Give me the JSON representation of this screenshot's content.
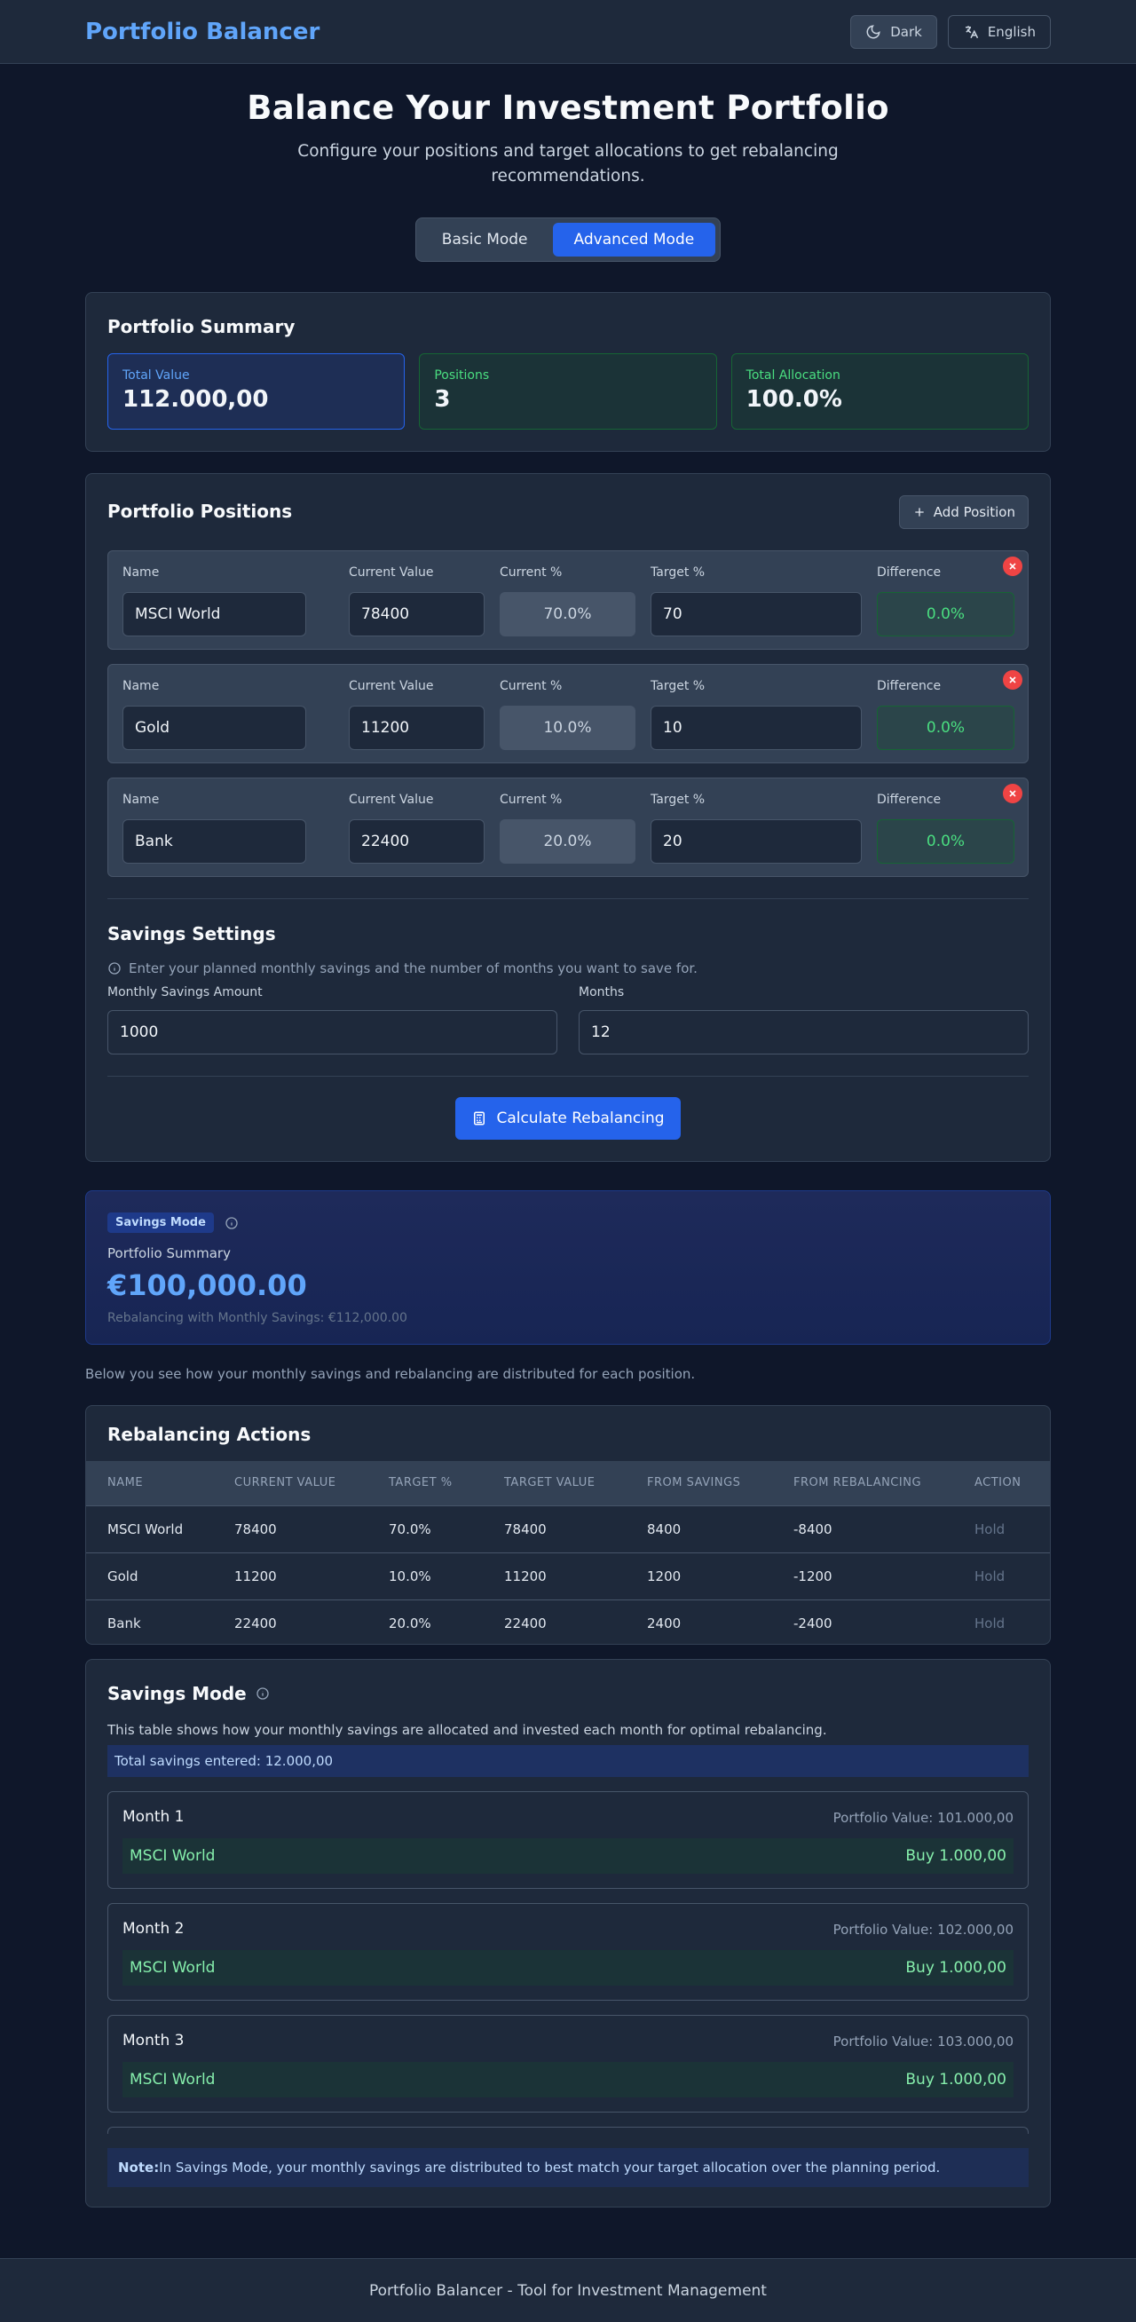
{
  "header": {
    "brand": "Portfolio Balancer",
    "theme_label": "Dark",
    "language_label": "English"
  },
  "hero": {
    "title": "Balance Your Investment Portfolio",
    "subtitle": "Configure your positions and target allocations to get rebalancing recommendations.",
    "modes": [
      "Basic Mode",
      "Advanced Mode"
    ],
    "active_mode": "Advanced Mode"
  },
  "summary": {
    "title": "Portfolio Summary",
    "total_value_label": "Total Value",
    "total_value": "112.000,00",
    "positions_label": "Positions",
    "positions": "3",
    "allocation_label": "Total Allocation",
    "allocation": "100.0%"
  },
  "positions": {
    "title": "Portfolio Positions",
    "add_label": "Add Position",
    "col_labels": {
      "name": "Name",
      "current_value": "Current Value",
      "current_pct": "Current %",
      "target_pct": "Target %",
      "difference": "Difference"
    },
    "rows": [
      {
        "name": "MSCI World",
        "current_value": "78400",
        "current_pct": "70.0%",
        "target_pct": "70",
        "difference": "0.0%"
      },
      {
        "name": "Gold",
        "current_value": "11200",
        "current_pct": "10.0%",
        "target_pct": "10",
        "difference": "0.0%"
      },
      {
        "name": "Bank",
        "current_value": "22400",
        "current_pct": "20.0%",
        "target_pct": "20",
        "difference": "0.0%"
      }
    ]
  },
  "savings_settings": {
    "title": "Savings Settings",
    "hint": "Enter your planned monthly savings and the number of months you want to save for.",
    "monthly_label": "Monthly Savings Amount",
    "monthly_value": "1000",
    "months_label": "Months",
    "months_value": "12",
    "calc_label": "Calculate Rebalancing"
  },
  "savings_summary": {
    "badge": "Savings Mode",
    "label": "Portfolio Summary",
    "value": "€100,000.00",
    "sub": "Rebalancing with Monthly Savings: €112,000.00"
  },
  "intro_text": "Below you see how your monthly savings and rebalancing are distributed for each position.",
  "actions": {
    "title": "Rebalancing Actions",
    "headers": [
      "NAME",
      "CURRENT VALUE",
      "TARGET %",
      "TARGET VALUE",
      "FROM SAVINGS",
      "FROM REBALANCING",
      "ACTION"
    ],
    "rows": [
      [
        "MSCI World",
        "78400",
        "70.0%",
        "78400",
        "8400",
        "-8400",
        "Hold"
      ],
      [
        "Gold",
        "11200",
        "10.0%",
        "11200",
        "1200",
        "-1200",
        "Hold"
      ],
      [
        "Bank",
        "22400",
        "20.0%",
        "22400",
        "2400",
        "-2400",
        "Hold"
      ]
    ]
  },
  "savings_mode": {
    "title": "Savings Mode",
    "desc": "This table shows how your monthly savings are allocated and invested each month for optimal rebalancing.",
    "total": "Total savings entered: 12.000,00",
    "months": [
      {
        "title": "Month 1",
        "value": "Portfolio Value: 101.000,00",
        "asset": "MSCI World",
        "buy": "Buy 1.000,00"
      },
      {
        "title": "Month 2",
        "value": "Portfolio Value: 102.000,00",
        "asset": "MSCI World",
        "buy": "Buy 1.000,00"
      },
      {
        "title": "Month 3",
        "value": "Portfolio Value: 103.000,00",
        "asset": "MSCI World",
        "buy": "Buy 1.000,00"
      }
    ],
    "note_bold": "Note:",
    "note": " In Savings Mode, your monthly savings are distributed to best match your target allocation over the planning period."
  },
  "footer": "Portfolio Balancer - Tool for Investment Management"
}
